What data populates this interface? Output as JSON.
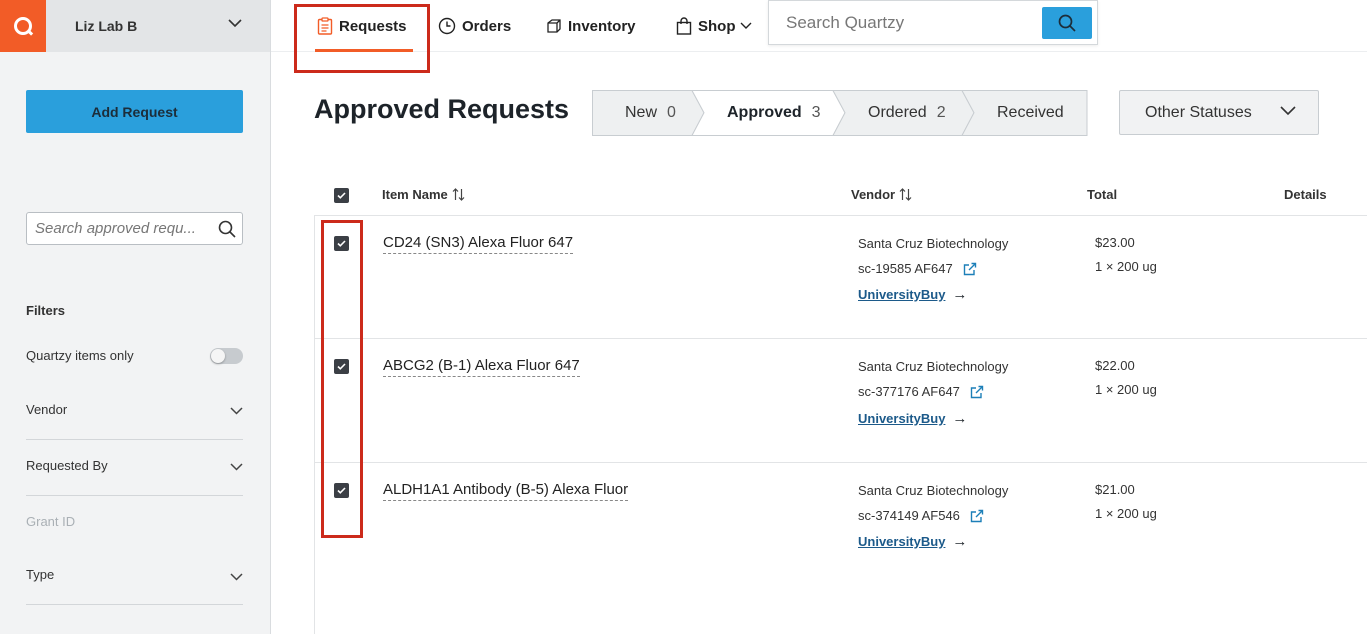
{
  "sidebar": {
    "lab_name": "Liz Lab B",
    "add_request_label": "Add Request",
    "search_placeholder": "Search approved requ...",
    "filters_title": "Filters",
    "quartzy_only_label": "Quartzy items only",
    "filters": [
      {
        "label": "Vendor"
      },
      {
        "label": "Requested By"
      },
      {
        "label": "Grant ID"
      },
      {
        "label": "Type"
      }
    ]
  },
  "topnav": {
    "items": [
      {
        "label": "Requests",
        "icon": "clipboard-icon"
      },
      {
        "label": "Orders",
        "icon": "clock-icon"
      },
      {
        "label": "Inventory",
        "icon": "boxes-icon"
      },
      {
        "label": "Shop",
        "icon": "shopping-bag-icon"
      }
    ],
    "search_placeholder": "Search Quartzy"
  },
  "main": {
    "title": "Approved Requests",
    "status_tabs": [
      {
        "label": "New",
        "count": "0"
      },
      {
        "label": "Approved",
        "count": "3"
      },
      {
        "label": "Ordered",
        "count": "2"
      },
      {
        "label": "Received",
        "count": ""
      }
    ],
    "other_statuses_label": "Other Statuses"
  },
  "table": {
    "headers": {
      "item_name": "Item Name",
      "vendor": "Vendor",
      "total": "Total",
      "details": "Details"
    },
    "rows": [
      {
        "item": "CD24 (SN3) Alexa Fluor 647",
        "vendor": "Santa Cruz Biotechnology",
        "catalog": "sc-19585 AF647",
        "link": "UniversityBuy",
        "price": "$23.00",
        "qty": "1 × 200 ug"
      },
      {
        "item": "ABCG2 (B-1) Alexa Fluor 647",
        "vendor": "Santa Cruz Biotechnology",
        "catalog": "sc-377176 AF647",
        "link": "UniversityBuy",
        "price": "$22.00",
        "qty": "1 × 200 ug"
      },
      {
        "item": "ALDH1A1 Antibody (B-5) Alexa Fluor",
        "vendor": "Santa Cruz Biotechnology",
        "catalog": "sc-374149 AF546",
        "link": "UniversityBuy",
        "price": "$21.00",
        "qty": "1 × 200 ug"
      }
    ]
  },
  "colors": {
    "brand": "#f25c27",
    "primary": "#2a9fdc",
    "highlight": "#cc2a1b"
  }
}
